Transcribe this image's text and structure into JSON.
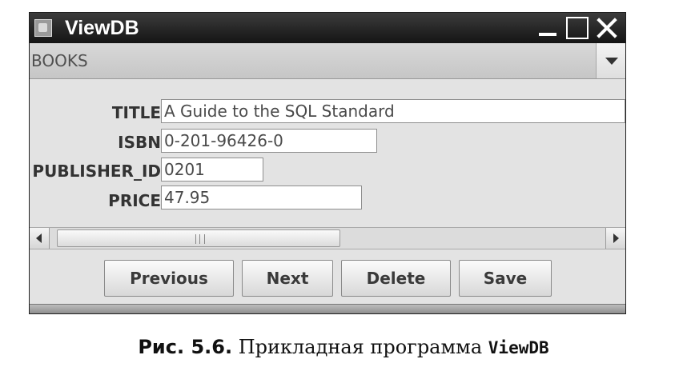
{
  "window": {
    "title": "ViewDB",
    "icon": "java-app-icon",
    "controls": [
      "minimize-icon",
      "maximize-icon",
      "close-icon"
    ]
  },
  "table_select": {
    "selected": "BOOKS"
  },
  "fields": [
    {
      "label": "TITLE",
      "value": "A Guide to the SQL Standard"
    },
    {
      "label": "ISBN",
      "value": "0-201-96426-0"
    },
    {
      "label": "PUBLISHER_ID",
      "value": "0201"
    },
    {
      "label": "PRICE",
      "value": "47.95"
    }
  ],
  "buttons": {
    "previous": "Previous",
    "next": "Next",
    "delete": "Delete",
    "save": "Save"
  },
  "caption": {
    "number": "Рис. 5.6.",
    "text": "Прикладная программа",
    "code": "ViewDB"
  }
}
